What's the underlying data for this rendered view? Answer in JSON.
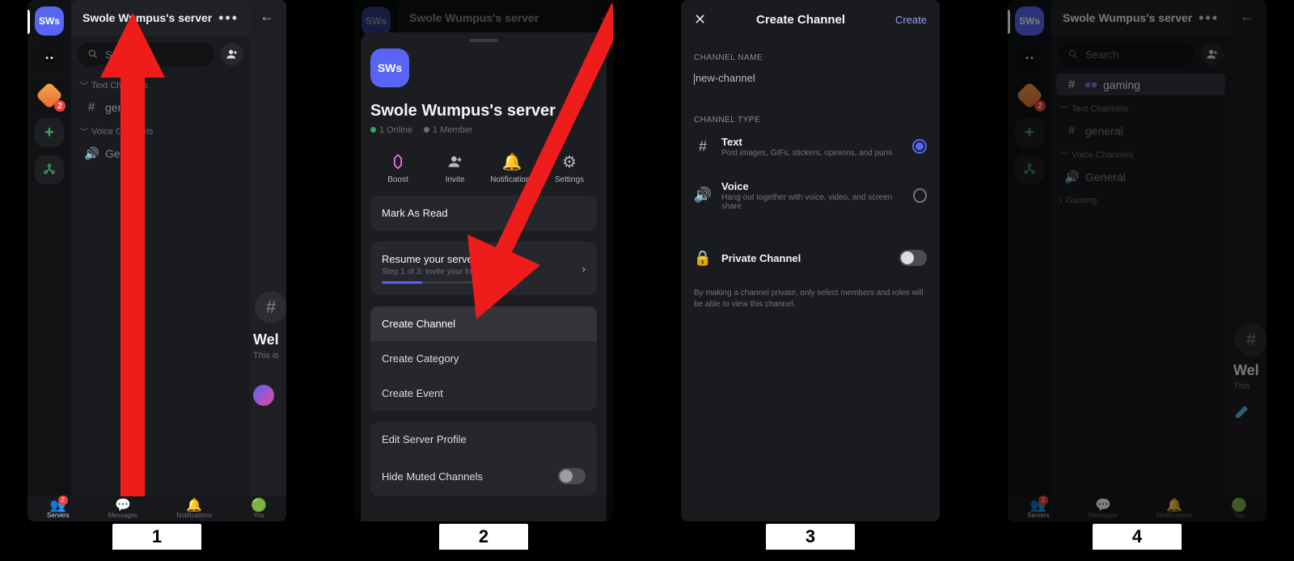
{
  "steps": [
    "1",
    "2",
    "3",
    "4"
  ],
  "server": {
    "name": "Swole Wumpus's server",
    "avatar_text": "SWs",
    "online": "1 Online",
    "members": "1 Member"
  },
  "search": {
    "placeholder": "Search"
  },
  "rail": {
    "badge": "2"
  },
  "categories": {
    "text_channels": "Text Channels",
    "voice_channels": "Voice Channels",
    "gaming": "Gaming"
  },
  "channels": {
    "general": "general",
    "general_voice": "General",
    "gaming": "gaming"
  },
  "bottom_nav": {
    "servers": "Servers",
    "messages": "Messages",
    "notifications": "Notifications",
    "you": "You",
    "badge": "2"
  },
  "main_peek": {
    "welcome": "Wel",
    "welcome4": "Wel",
    "sub": "This is",
    "sub4": "This"
  },
  "sheet": {
    "actions": {
      "boost": "Boost",
      "invite": "Invite",
      "notifications": "Notifications",
      "settings": "Settings"
    },
    "mark_read": "Mark As Read",
    "resume_title": "Resume your server setup",
    "resume_sub": "Step 1 of 3: Invite your friends",
    "create_channel": "Create Channel",
    "create_category": "Create Category",
    "create_event": "Create Event",
    "edit_profile": "Edit Server Profile",
    "hide_muted": "Hide Muted Channels"
  },
  "create": {
    "title": "Create Channel",
    "done": "Create",
    "name_label": "CHANNEL NAME",
    "name_placeholder": "new-channel",
    "type_label": "CHANNEL TYPE",
    "text_title": "Text",
    "text_sub": "Post images, GIFs, stickers, opinions, and puns",
    "voice_title": "Voice",
    "voice_sub": "Hang out together with voice, video, and screen share",
    "private": "Private Channel",
    "private_help": "By making a channel private, only select members and roles will be able to view this channel."
  }
}
